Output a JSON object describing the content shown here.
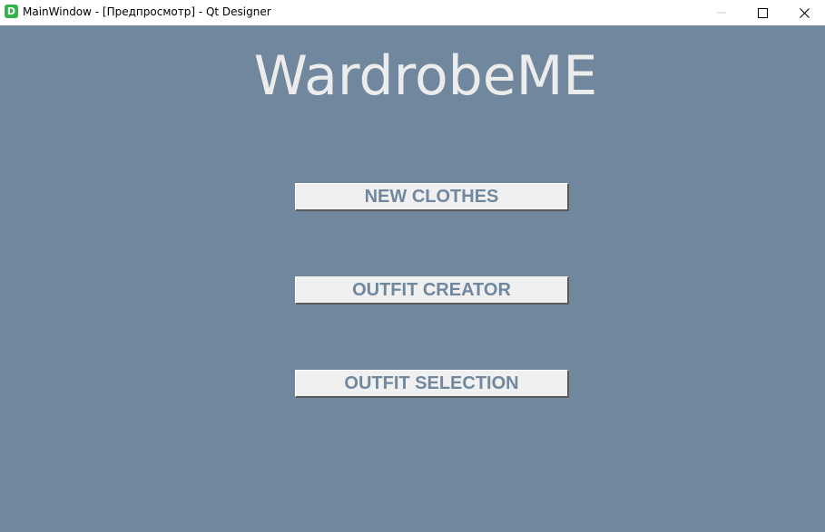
{
  "window": {
    "title": "MainWindow - [Предпросмотр] - Qt Designer",
    "app_icon_letter": "D"
  },
  "app": {
    "title": "WardrobeME",
    "buttons": {
      "new_clothes": "NEW CLOTHES",
      "outfit_creator": "OUTFIT CREATOR",
      "outfit_selection": "OUTFIT SELECTION"
    }
  },
  "colors": {
    "background": "#71879e",
    "button_face": "#f0f0f0",
    "button_text": "#71879e",
    "title_text": "#ececec"
  },
  "icons": {
    "app": "qt-designer-icon",
    "minimize": "minimize-icon",
    "maximize": "maximize-icon",
    "close": "close-icon"
  }
}
